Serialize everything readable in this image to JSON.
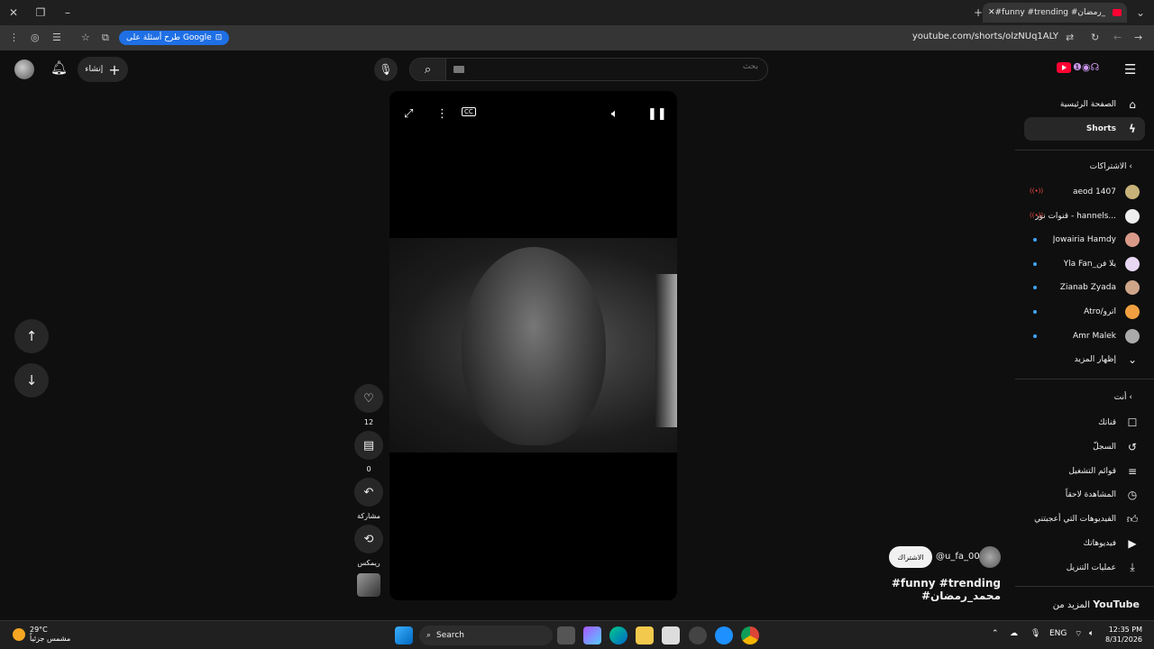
{
  "browser": {
    "tab_title": "#funny #trending #محمد_رمضان",
    "ai_chip": "طرح أسئلة على Google",
    "url": "youtube.com/shorts/olzNUq1ALY"
  },
  "header": {
    "create_label": "إنشاء",
    "search_placeholder": "بحث"
  },
  "actions": {
    "likes": "12",
    "comments": "0",
    "share": "مشاركة",
    "remix": "ريمكس"
  },
  "video": {
    "channel_handle": "@u_fa_00",
    "subscribe": "الاشتراك",
    "title": "#funny #trending #محمد_رمضان"
  },
  "sidebar": {
    "home": "الصفحة الرئيسية",
    "shorts": "Shorts",
    "subscriptions_header": "الاشتراكات",
    "subscriptions": [
      {
        "name": "aeod 1407",
        "status": "live"
      },
      {
        "name": "قنوات نور - hannels...",
        "status": "live"
      },
      {
        "name": "Jowairia Hamdy",
        "status": "new"
      },
      {
        "name": "Yla Fan_يلا فن",
        "status": "new"
      },
      {
        "name": "Zianab Zyada",
        "status": "new"
      },
      {
        "name": "Atro/أترو",
        "status": "new"
      },
      {
        "name": "Amr Malek",
        "status": "new"
      }
    ],
    "show_more": "إظهار المزيد",
    "you_header": "أنت",
    "you_items": [
      {
        "label": "قناتك",
        "icon": "channel-icon"
      },
      {
        "label": "السجلّ",
        "icon": "history-icon"
      },
      {
        "label": "قوائم التشغيل",
        "icon": "playlists-icon"
      },
      {
        "label": "المشاهدة لاحقاً",
        "icon": "watch-later-icon"
      },
      {
        "label": "الفيديوهات التي أعجبتني",
        "icon": "liked-icon"
      },
      {
        "label": "فيديوهاتك",
        "icon": "your-videos-icon"
      },
      {
        "label": "عمليات التنزيل",
        "icon": "downloads-icon"
      }
    ],
    "more_from": "المزيد من",
    "more_from_brand": "YouTube"
  },
  "taskbar": {
    "temp": "29°C",
    "weather_desc": "مشمس جزئياً",
    "search": "Search",
    "lang": "ENG",
    "time": "12:35 PM",
    "date": "8/31/2026"
  }
}
